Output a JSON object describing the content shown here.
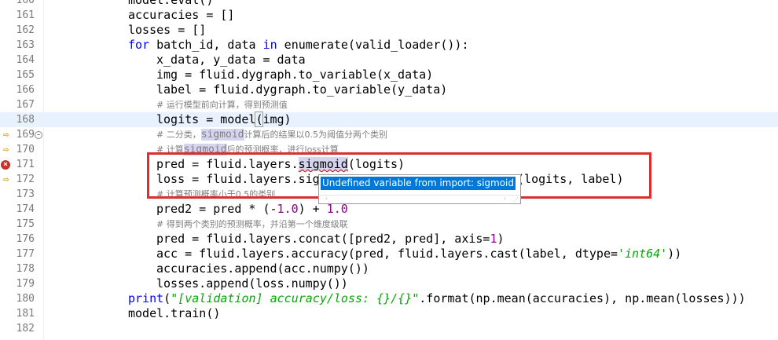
{
  "editor": {
    "tooltip": {
      "message": "Undefined variable from import: sigmoid"
    },
    "lines": [
      {
        "n": "160",
        "code": "model.eval()"
      },
      {
        "n": "161",
        "code": "accuracies = []"
      },
      {
        "n": "162",
        "code": "losses = []"
      },
      {
        "n": "163",
        "kw": "for",
        "a": " batch_id, data ",
        "kw2": "in",
        "b": " enumerate(valid_loader()):"
      },
      {
        "n": "164",
        "code": "x_data, y_data = data"
      },
      {
        "n": "165",
        "code": "img = fluid.dygraph.to_variable(x_data)"
      },
      {
        "n": "166",
        "code": "label = fluid.dygraph.to_variable(y_data)"
      },
      {
        "n": "167",
        "comment": "# 运行模型前向计算，得到预测值"
      },
      {
        "n": "168",
        "a": "logits = model",
        "paren": "(",
        "b": "img)"
      },
      {
        "n": "169",
        "c1": "# 二分类，",
        "occ": "sigmoid",
        "c2": "计算后的结果以0.5为阈值分两个类别"
      },
      {
        "n": "170",
        "c1": "# 计算",
        "occ": "sigmoid",
        "c2": "后的预测概率，进行loss计算"
      },
      {
        "n": "171",
        "a": "pred = fluid.layers.",
        "occ": "sigmoid",
        "b": "(logits)"
      },
      {
        "n": "172",
        "a": "loss = fluid.layers.sig",
        "b": "s(logits, label)"
      },
      {
        "n": "173",
        "comment": "# 计算预测概率小于0.5的类别"
      },
      {
        "n": "174",
        "a": "pred2 = pred * (-",
        "num1": "1.0",
        "b": ") + ",
        "num2": "1.0"
      },
      {
        "n": "175",
        "comment": "# 得到两个类别的预测概率，并沿第一个维度级联"
      },
      {
        "n": "176",
        "a": "pred = fluid.layers.concat([pred2, pred], axis=",
        "num1": "1",
        "b": ")"
      },
      {
        "n": "177",
        "a": "acc = fluid.layers.accuracy(pred, fluid.layers.cast(label, dtype=",
        "str": "'int64'",
        "b": "))"
      },
      {
        "n": "178",
        "code": "accuracies.append(acc.numpy())"
      },
      {
        "n": "179",
        "code": "losses.append(loss.numpy())"
      },
      {
        "n": "180",
        "kw": "print",
        "a": "(",
        "str": "\"[validation] accuracy/loss: {}/{}\"",
        "b": ".format(np.mean(accuracies), np.mean(losses)))"
      },
      {
        "n": "181",
        "code": "model.train()"
      },
      {
        "n": "182",
        "code": ""
      }
    ]
  }
}
